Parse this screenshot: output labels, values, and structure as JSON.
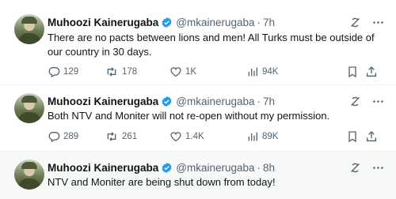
{
  "tweets": [
    {
      "author_name": "Muhoozi Kainerugaba",
      "handle": "@mkainerugaba",
      "separator": "·",
      "time": "7h",
      "text": "There are no pacts between lions and men! All Turks must be outside of our country in 30 days.",
      "replies": "129",
      "retweets": "178",
      "likes": "1K",
      "views": "94K"
    },
    {
      "author_name": "Muhoozi Kainerugaba",
      "handle": "@mkainerugaba",
      "separator": "·",
      "time": "7h",
      "text": "Both NTV and Moniter will not re-open without my permission.",
      "replies": "289",
      "retweets": "261",
      "likes": "1.4K",
      "views": "89K"
    },
    {
      "author_name": "Muhoozi Kainerugaba",
      "handle": "@mkainerugaba",
      "separator": "·",
      "time": "8h",
      "text": "NTV and Moniter are being shut down from today!"
    }
  ],
  "colors": {
    "text": "#0f1419",
    "secondary": "#536471",
    "verified": "#1d9bf0",
    "divider": "#eff3f4",
    "highlight_bg": "#f7f9f9"
  },
  "icons": [
    "verified-badge-icon",
    "grok-icon",
    "more-icon",
    "reply-icon",
    "retweet-icon",
    "like-icon",
    "views-icon",
    "bookmark-icon",
    "share-icon"
  ]
}
